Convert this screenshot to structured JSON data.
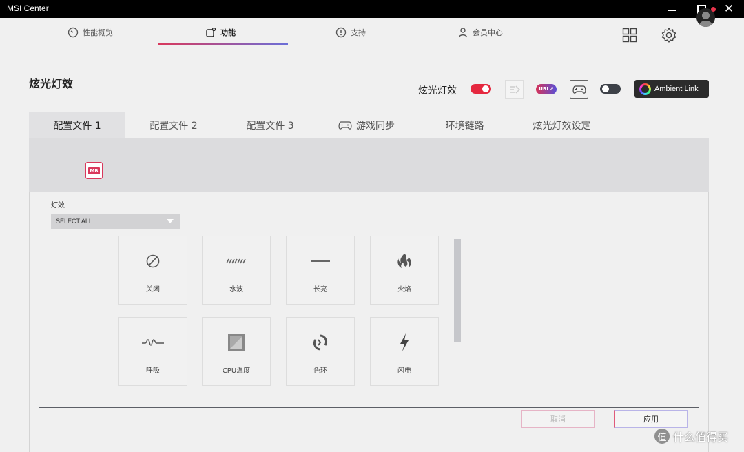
{
  "window": {
    "title": "MSI Center"
  },
  "nav": {
    "performance": "性能概览",
    "features": "功能",
    "support": "支持",
    "member": "会员中心"
  },
  "header": {
    "page_title": "炫光灯效",
    "toggle_label": "炫光灯效",
    "url_badge": "URL↗",
    "ambient_link": "Ambient Link"
  },
  "tabs": [
    {
      "label": "配置文件 1"
    },
    {
      "label": "配置文件 2"
    },
    {
      "label": "配置文件 3"
    },
    {
      "label": "游戏同步"
    },
    {
      "label": "环境链路"
    },
    {
      "label": "炫光灯效设定"
    }
  ],
  "device": {
    "badge": "MB"
  },
  "effects": {
    "label": "灯效",
    "select_value": "SELECT ALL",
    "items": [
      {
        "label": "关闭",
        "icon": "off-icon"
      },
      {
        "label": "水波",
        "icon": "wave-icon"
      },
      {
        "label": "长亮",
        "icon": "steady-icon"
      },
      {
        "label": "火焰",
        "icon": "flame-icon"
      },
      {
        "label": "呼吸",
        "icon": "breathing-icon"
      },
      {
        "label": "CPU温度",
        "icon": "cpu-temperature-icon"
      },
      {
        "label": "色环",
        "icon": "color-ring-icon"
      },
      {
        "label": "闪电",
        "icon": "lightning-icon"
      }
    ]
  },
  "actions": {
    "cancel": "取消",
    "apply": "应用"
  },
  "watermark": {
    "logo": "值",
    "text": "什么值得买"
  },
  "colors": {
    "accent": "#e5283f",
    "gradient_end": "#6b6fd8"
  }
}
